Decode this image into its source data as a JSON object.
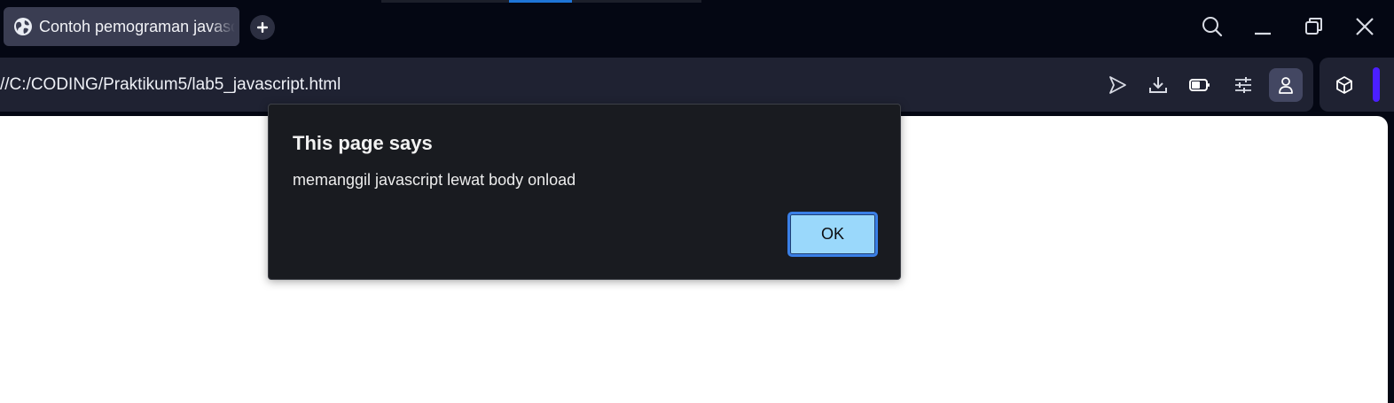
{
  "browser": {
    "tab": {
      "title": "Contoh pemograman javascript",
      "favicon": "globe-icon"
    },
    "new_tab_icon": "plus-icon",
    "window_controls": {
      "search_icon": "search-icon",
      "minimize_icon": "minimize-icon",
      "restore_icon": "restore-icon",
      "close_icon": "close-icon"
    },
    "address_bar": {
      "url": "//C:/CODING/Praktikum5/lab5_javascript.html"
    },
    "toolbar_icons": [
      "send-icon",
      "download-icon",
      "battery-saver-icon",
      "settings-sliders-icon",
      "profile-icon",
      "extensions-cube-icon"
    ]
  },
  "dialog": {
    "title": "This page says",
    "message": "memanggil javascript lewat body onload",
    "ok_label": "OK"
  },
  "colors": {
    "chrome_background": "#040713",
    "address_bar": "#1f2232",
    "tab_active": "#3a3d52",
    "dialog_background": "#191b20",
    "ok_button": "#9ad8fb",
    "ok_border": "#3a7fe6",
    "accent": "#4b1fff"
  }
}
